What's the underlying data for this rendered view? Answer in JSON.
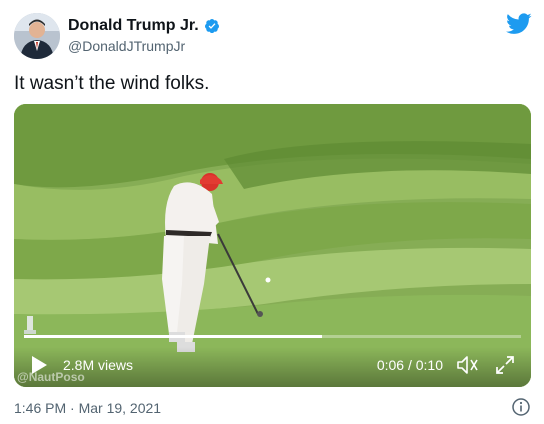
{
  "author": {
    "display_name": "Donald Trump Jr.",
    "handle": "@DonaldJTrumpJr",
    "verified": true,
    "avatar_icon": "profile-avatar"
  },
  "tweet": {
    "text": "It wasn’t the wind folks."
  },
  "video": {
    "views": "2.8M views",
    "time_display": "0:06 / 0:10",
    "progress": 0.6,
    "watermark": "@NautPoso",
    "controls": [
      "play-icon",
      "volume-icon",
      "fullscreen-icon"
    ]
  },
  "footer": {
    "timestamp": "1:46 PM · Mar 19, 2021",
    "info_icon": "info-icon"
  },
  "colors": {
    "twitter_blue": "#1d9bf0",
    "text_primary": "#0f1419",
    "text_secondary": "#536471",
    "grass_light": "#8fb55a",
    "grass_dark": "#5f8a32",
    "cap_red": "#d9322b"
  }
}
